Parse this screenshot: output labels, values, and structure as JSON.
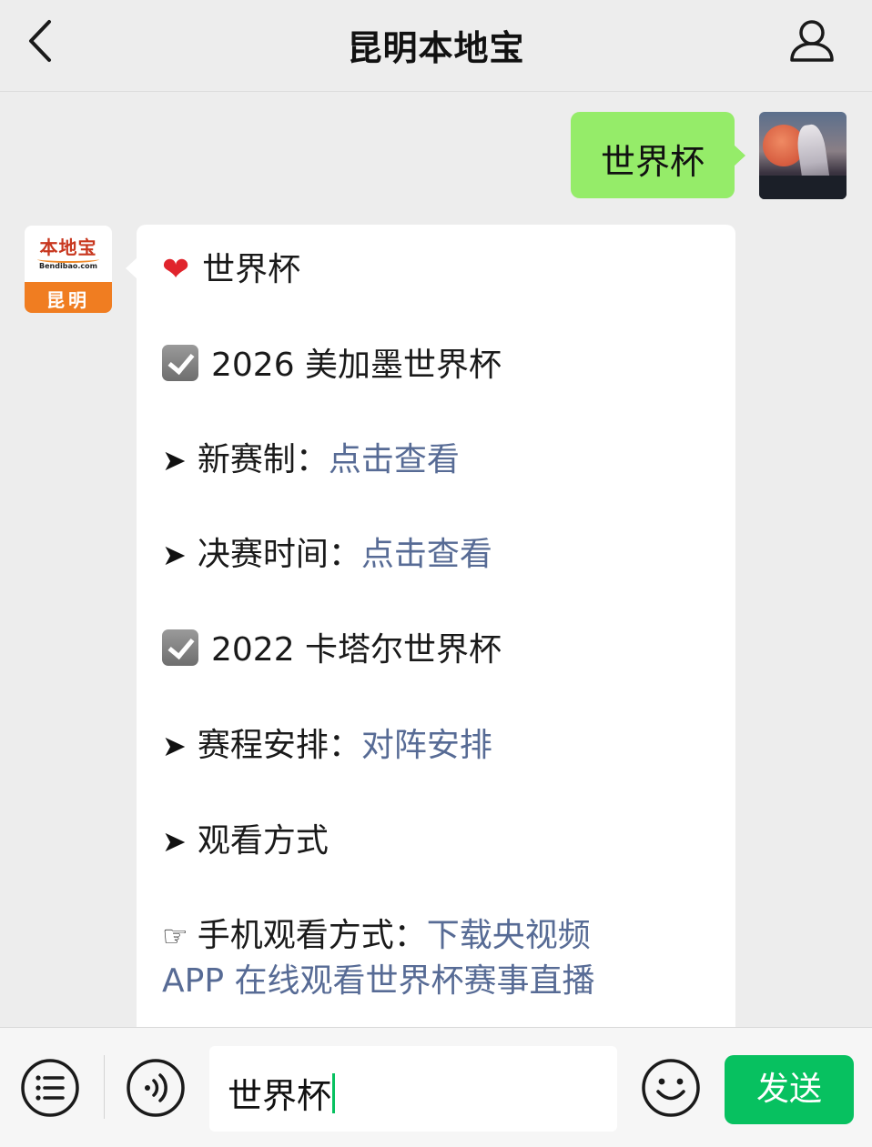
{
  "header": {
    "title": "昆明本地宝",
    "back_icon": "chevron-left-icon",
    "profile_icon": "person-icon"
  },
  "chat": {
    "outgoing": {
      "text": "世界杯",
      "bubble_color": "#95ec69"
    },
    "bot_avatar": {
      "brand": "本地宝",
      "domain": "Bendibao.com",
      "city": "昆明",
      "accent_color": "#f07d21"
    },
    "incoming": {
      "lines": [
        {
          "icon": "heart-icon",
          "text": "世界杯"
        },
        {
          "icon": "check-box-icon",
          "text": "2026 美加墨世界杯"
        },
        {
          "icon": "arrow-right-icon",
          "text": "新赛制：",
          "link": "点击查看"
        },
        {
          "icon": "arrow-right-icon",
          "text": "决赛时间：",
          "link": "点击查看"
        },
        {
          "icon": "check-box-icon",
          "text": "2022 卡塔尔世界杯"
        },
        {
          "icon": "arrow-right-icon",
          "text": "赛程安排：",
          "link": "对阵安排"
        },
        {
          "icon": "arrow-right-icon",
          "text": "观看方式"
        },
        {
          "icon": "pointing-hand-icon",
          "text": "手机观看方式：",
          "link": "下载央视频",
          "link_line2": "APP 在线观看世界杯赛事直播"
        }
      ],
      "link_color": "#576b95"
    }
  },
  "input_bar": {
    "menu_icon": "list-menu-icon",
    "voice_icon": "voice-icon",
    "input_value": "世界杯",
    "emoji_icon": "smile-icon",
    "send_label": "发送",
    "send_color": "#07c160"
  }
}
